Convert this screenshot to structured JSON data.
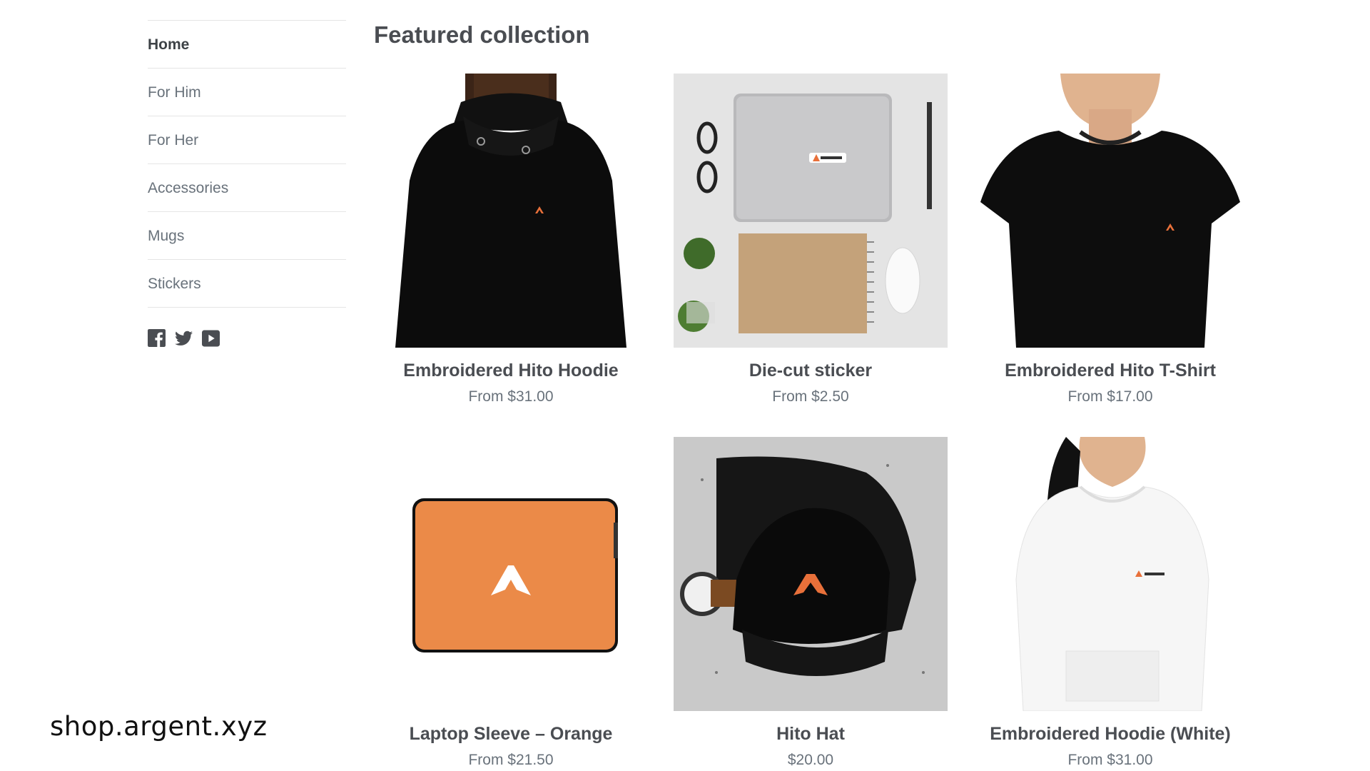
{
  "sidebar": {
    "items": [
      {
        "label": "Home",
        "active": true
      },
      {
        "label": "For Him"
      },
      {
        "label": "For Her"
      },
      {
        "label": "Accessories"
      },
      {
        "label": "Mugs"
      },
      {
        "label": "Stickers"
      }
    ],
    "social_icons": [
      "facebook-icon",
      "twitter-icon",
      "youtube-icon"
    ]
  },
  "main": {
    "heading": "Featured collection",
    "products": [
      {
        "title": "Embroidered Hito Hoodie",
        "price": "From $31.00",
        "image": "black-hoodie-model"
      },
      {
        "title": "Die-cut sticker",
        "price": "From $2.50",
        "image": "laptop-with-sticker"
      },
      {
        "title": "Embroidered Hito T-Shirt",
        "price": "From $17.00",
        "image": "black-tshirt-model"
      },
      {
        "title": "Laptop Sleeve – Orange",
        "price": "From $21.50",
        "image": "orange-laptop-sleeve"
      },
      {
        "title": "Hito Hat",
        "price": "$20.00",
        "image": "black-cap"
      },
      {
        "title": "Embroidered Hoodie (White)",
        "price": "From $31.00",
        "image": "white-hoodie-model"
      }
    ]
  },
  "overlay": {
    "url_text": "shop.argent.xyz"
  },
  "colors": {
    "accent": "#e8703a",
    "sleeve": "#eb8a48",
    "text": "#3d4246",
    "muted": "#69727b"
  }
}
